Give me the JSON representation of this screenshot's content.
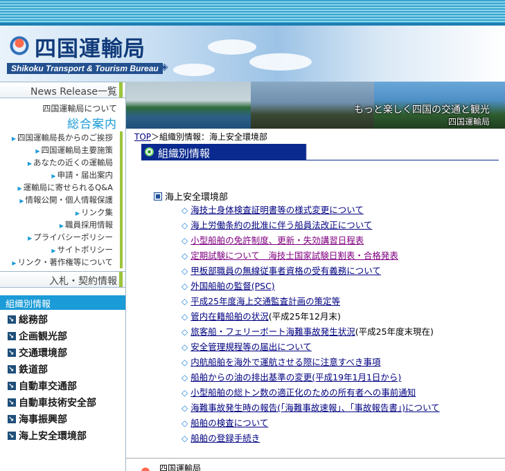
{
  "header": {
    "title": "四国運輸局",
    "subtitle": "Shikoku Transport & Tourism Bureau"
  },
  "banner_photos": {
    "tagline": "もっと楽しく四国の交通と観光",
    "tagline_org": "四国運輸局"
  },
  "sidebar": {
    "news_release": "News Release一覧",
    "about_small": "四国運輸局について",
    "about_big": "総合案内",
    "menu": [
      "四国運輸局長からのご挨拶",
      "四国運輸局主要施策",
      "あなたの近くの運輸局",
      "申請・届出案内",
      "運輸局に寄せられるQ&A",
      "情報公開・個人情報保護",
      "リンク集",
      "職員採用情報",
      "プライバシーポリシー",
      "サイトポリシー",
      "リンク・著作権等について"
    ],
    "bids": "入札・契約情報",
    "org_head": "組織別情報",
    "org_items": [
      "総務部",
      "企画観光部",
      "交通環境部",
      "鉄道部",
      "自動車交通部",
      "自動車技術安全部",
      "海事振興部",
      "海上安全環境部"
    ]
  },
  "breadcrumb": {
    "top": "TOP",
    "sep": "＞",
    "current": "組織別情報：海上安全環境部"
  },
  "section": {
    "title": "組織別情報"
  },
  "department": {
    "name": "海上安全環境部",
    "links": [
      {
        "text": "海技士身体検査証明書等の様式変更について",
        "note": ""
      },
      {
        "text": "海上労働条約の批准に伴う船員法改正について",
        "note": ""
      },
      {
        "text": "小型船舶の免許制度、更新・失効講習日程表",
        "note": ""
      },
      {
        "text": "定期試験について　海技士国家試験日割表・合格発表",
        "note": ""
      },
      {
        "text": "甲板部職員の無線従事者資格の受有義務について",
        "note": ""
      },
      {
        "text": "外国船舶の監督(PSC)",
        "note": ""
      },
      {
        "text": "平成25年度海上交通監査計画の策定等",
        "note": ""
      },
      {
        "text": "管内在籍船舶の状況",
        "note": "(平成25年12月末)"
      },
      {
        "text": "旅客船・フェリーボート海難事故発生状況",
        "note": "(平成25年度末現在)"
      },
      {
        "text": "安全管理規程等の届出について",
        "note": ""
      },
      {
        "text": "内航船舶を海外で運航させる際に注意すべき事項",
        "note": ""
      },
      {
        "text": "船舶からの油の排出基準の変更(平成19年1月1日から)",
        "note": ""
      },
      {
        "text": "小型船舶の総トン数の適正化のための所有者への事前通知",
        "note": ""
      },
      {
        "text": "海難事故発生時の報告(「海難事故速報」、「事故報告書」)について",
        "note": ""
      },
      {
        "text": "船舶の検査について",
        "note": ""
      },
      {
        "text": "船舶の登録手続き",
        "note": ""
      }
    ]
  },
  "footer": {
    "org": "四国運輸局"
  },
  "colors": {
    "accent": "#1b9bd7",
    "navy": "#0a2a8f",
    "green": "#9bc53d",
    "link": "#000080"
  }
}
